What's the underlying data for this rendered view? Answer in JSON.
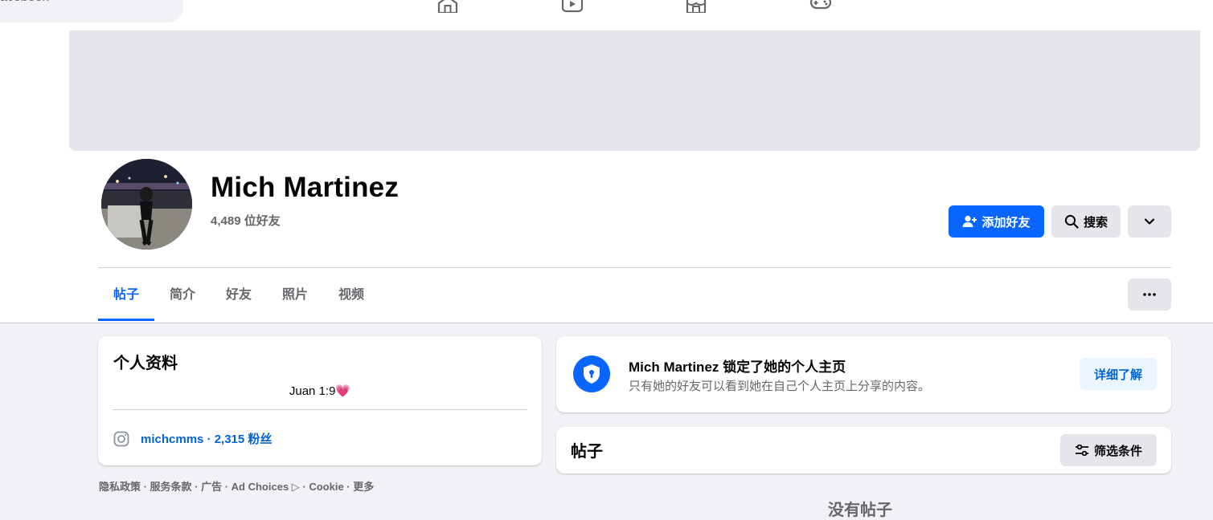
{
  "topbar": {
    "search_text": "acebook",
    "nav_icons": [
      "home-icon",
      "video-icon",
      "marketplace-icon",
      "gaming-icon"
    ]
  },
  "profile": {
    "name": "Mich Martinez",
    "friends": "4,489 位好友",
    "add_friend_label": "添加好友",
    "search_label": "搜索"
  },
  "tabs": [
    "帖子",
    "简介",
    "好友",
    "照片",
    "视频"
  ],
  "intro": {
    "title": "个人资料",
    "bio": "Juan 1:9",
    "bio_emoji": "💗",
    "instagram": "michcmms · 2,315 粉丝"
  },
  "footer": "隐私政策 · 服务条款 · 广告 · Ad Choices ▷ · Cookie · 更多",
  "locked": {
    "title": "Mich Martinez 锁定了她的个人主页",
    "description": "只有她的好友可以看到她在自己个人主页上分享的内容。",
    "learn_more": "详细了解"
  },
  "posts": {
    "title": "帖子",
    "filter_label": "筛选条件",
    "empty_text": "没有帖子"
  },
  "colors": {
    "accent": "#0866ff",
    "link": "#0064d1",
    "page_bg": "#f0f2f5"
  }
}
